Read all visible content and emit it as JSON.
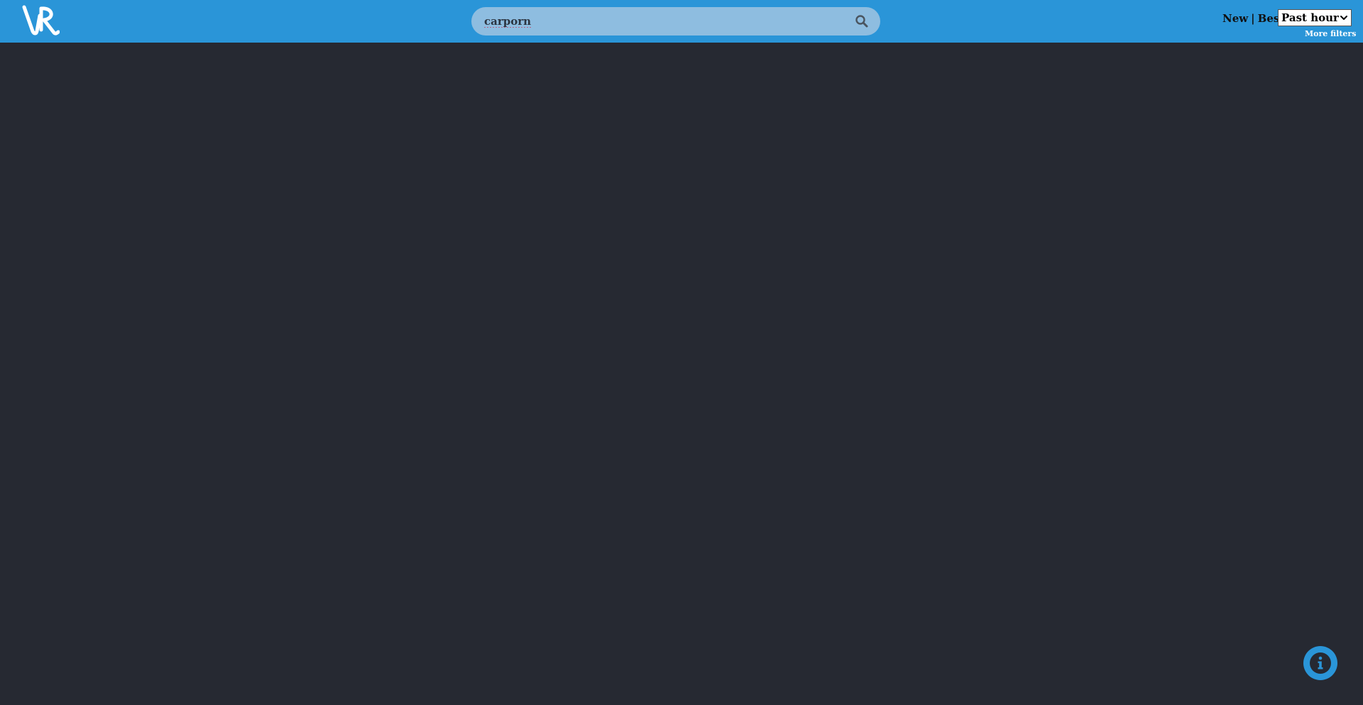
{
  "header": {
    "logo_icon": "vr-logo",
    "search": {
      "value": "carporn",
      "icon": "search-icon"
    },
    "sort": {
      "new_label": "New",
      "separator": "|",
      "best_label": "Best"
    },
    "time_filter": {
      "selected": "Past hour"
    },
    "more_filters_label": "More filters"
  },
  "info_button": {
    "icon": "info-icon"
  },
  "colors": {
    "header_bg": "#2a95d8",
    "page_bg": "#262932",
    "search_bg": "#8ebde0"
  }
}
